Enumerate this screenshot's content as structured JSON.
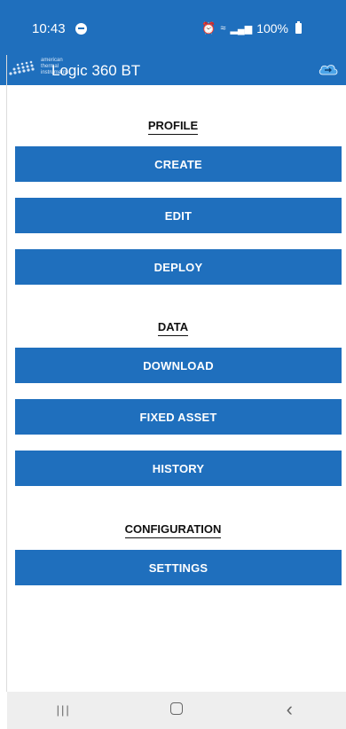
{
  "status_bar": {
    "time": "10:43",
    "battery": "100%",
    "icons": [
      "messenger-icon",
      "alarm-icon",
      "wifi-icon",
      "volte-icon",
      "signal-icon",
      "battery-icon"
    ]
  },
  "app_bar": {
    "logo_lines": [
      "american",
      "thermal",
      "instruments"
    ],
    "title": "Logic 360 BT",
    "cloud_icon": "cloud-sync-icon"
  },
  "sections": {
    "profile": {
      "title": "PROFILE",
      "buttons": [
        "CREATE",
        "EDIT",
        "DEPLOY"
      ]
    },
    "data": {
      "title": "DATA",
      "buttons": [
        "DOWNLOAD",
        "FIXED ASSET",
        "HISTORY"
      ]
    },
    "configuration": {
      "title": "CONFIGURATION",
      "buttons": [
        "SETTINGS"
      ]
    }
  },
  "nav_bar": {
    "icons": [
      "recents-icon",
      "home-icon",
      "back-icon"
    ]
  },
  "colors": {
    "primary": "#1f6fbd",
    "background": "#ffffff",
    "nav_bar": "#eeeeee"
  }
}
